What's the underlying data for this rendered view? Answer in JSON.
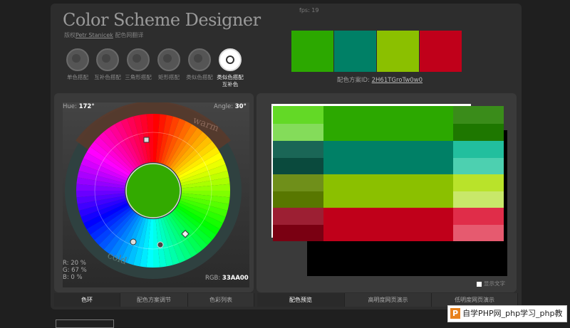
{
  "app": {
    "title": "Color Scheme Designer",
    "fps": "fps: 19",
    "credit": {
      "prefix": "版权",
      "author": "Petr Stanicek",
      "suffix": " 配色网翻译"
    }
  },
  "modes": [
    {
      "label": "单色搭配",
      "active": false
    },
    {
      "label": "互补色搭配",
      "active": false
    },
    {
      "label": "三角形搭配",
      "active": false
    },
    {
      "label": "矩形搭配",
      "active": false
    },
    {
      "label": "类似色搭配",
      "active": false
    },
    {
      "label": "类似色搭配互补色",
      "active": true
    }
  ],
  "scheme": {
    "swatches": [
      "#2ca800",
      "#008066",
      "#8bc000",
      "#c0001a"
    ],
    "id_label": "配色方案ID:",
    "id": "2H61TGroTw0w0"
  },
  "wheel": {
    "hue_label": "Hue:",
    "hue": "172°",
    "angle_label": "Angle:",
    "angle": "30°",
    "warm": "warm",
    "cold": "cold",
    "r": "R: 20 %",
    "g": "G: 67 %",
    "b": "B:   0 %",
    "rgb_label": "RGB:",
    "rgb": "33AA00",
    "center": "#33aa00"
  },
  "tabs_left": [
    "色环",
    "配色方案调节",
    "色彩列表"
  ],
  "tabs_right": [
    "配色预览",
    "高明度网页演示",
    "低明度网页演示"
  ],
  "preview": {
    "show_text": "显示文字",
    "rows": [
      {
        "left": [
          "#63d926",
          "#84dc5a"
        ],
        "main": "#2ca800",
        "right": [
          "#3a8c1a",
          "#1e7700"
        ]
      },
      {
        "left": [
          "#1a6656",
          "#0a4a3d"
        ],
        "main": "#008066",
        "right": [
          "#22bf9e",
          "#4dd0b0"
        ]
      },
      {
        "left": [
          "#6f8f1a",
          "#587700"
        ],
        "main": "#8bc000",
        "right": [
          "#b9e32a",
          "#c8e86a"
        ]
      },
      {
        "left": [
          "#9c1f33",
          "#7a0012"
        ],
        "main": "#c0001a",
        "right": [
          "#e02d49",
          "#e65a6f"
        ]
      }
    ]
  },
  "footer": {
    "text1": "自学PHP网",
    "text2": "_php学习_php教",
    "badge": "P"
  }
}
